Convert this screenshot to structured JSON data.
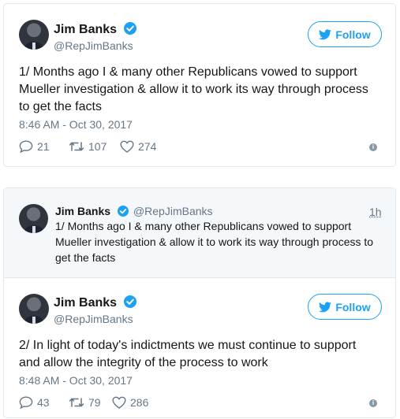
{
  "tweet1": {
    "name": "Jim Banks",
    "handle": "@RepJimBanks",
    "follow_label": "Follow",
    "text_lines": [
      "1/ Months ago I & many other Republicans vowed to support",
      "Mueller investigation & allow it to work its way through process",
      "to get the facts"
    ],
    "timestamp": "8:46 AM - Oct 30, 2017",
    "replies": "21",
    "retweets": "107",
    "likes": "274"
  },
  "quoted": {
    "name": "Jim Banks",
    "handle": "@RepJimBanks",
    "time_ago": "1h",
    "text_lines": [
      "1/ Months ago I & many other Republicans vowed to support",
      "Mueller investigation & allow it to work its way through process to",
      "get the facts"
    ]
  },
  "tweet2": {
    "name": "Jim Banks",
    "handle": "@RepJimBanks",
    "follow_label": "Follow",
    "text_lines": [
      "2/ In light of today's indictments we must continue to support",
      "and allow the integrity of the process to work"
    ],
    "timestamp": "8:48 AM - Oct 30, 2017",
    "replies": "43",
    "retweets": "79",
    "likes": "286"
  },
  "colors": {
    "accent": "#1da1f2",
    "muted": "#657786",
    "border": "#e1e8ed",
    "quote_bg": "#f5f8fa"
  },
  "icons": [
    "twitter-bird-icon",
    "verified-badge-icon",
    "reply-icon",
    "retweet-icon",
    "like-icon",
    "info-icon"
  ]
}
